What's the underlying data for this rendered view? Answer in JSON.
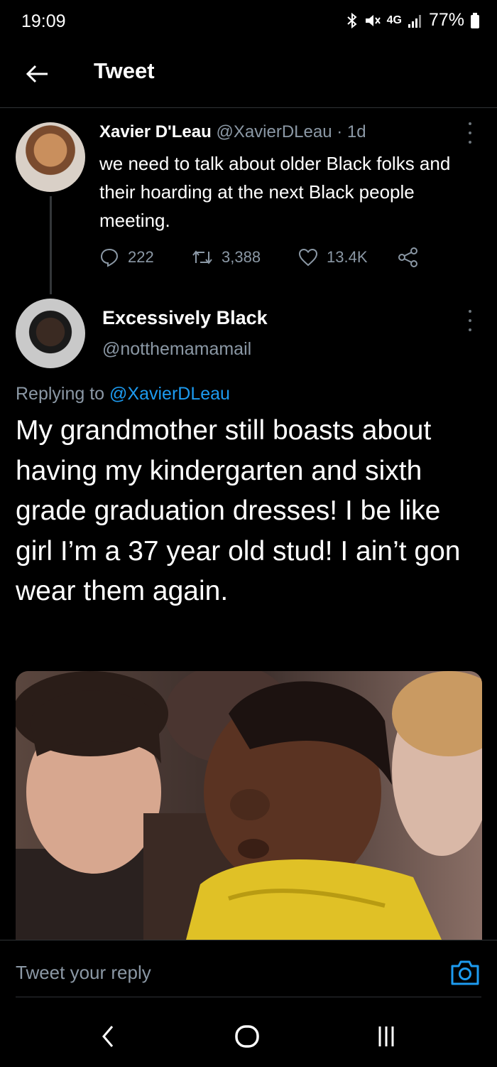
{
  "status_bar": {
    "time": "19:09",
    "network": "4G",
    "battery": "77%"
  },
  "header": {
    "title": "Tweet"
  },
  "parent_tweet": {
    "name": "Xavier D'Leau",
    "meta": "@XavierDLeau · 1d",
    "text": "we need to talk about older Black folks and their hoarding at the next Black people meeting.",
    "replies": "222",
    "retweets": "3,388",
    "likes": "13.4K"
  },
  "main_tweet": {
    "name": "Excessively Black",
    "handle": "@notthemamamail",
    "replying_prefix": "Replying to ",
    "replying_to": "@XavierDLeau",
    "text": "My grandmother still boasts about having my kindergarten and sixth grade graduation dresses! I be like girl I’m a 37 year old stud! I ain’t gon wear them again."
  },
  "reply_bar": {
    "placeholder": "Tweet your reply"
  },
  "colors": {
    "background": "#000000",
    "text": "#ffffff",
    "secondary": "#8b98a5",
    "link": "#1d9bf0",
    "divider": "#2f3336"
  }
}
